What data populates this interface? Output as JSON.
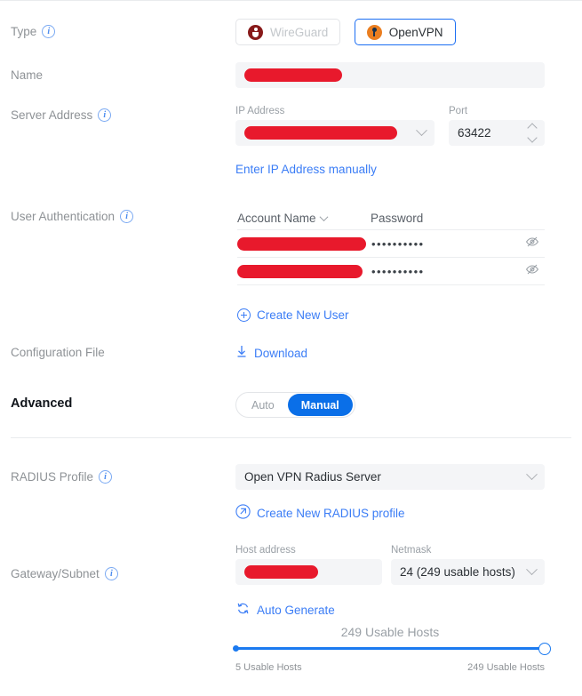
{
  "form": {
    "type": {
      "label": "Type",
      "options": [
        {
          "label": "WireGuard",
          "icon": "wireguard-icon",
          "selected": false,
          "disabled": true
        },
        {
          "label": "OpenVPN",
          "icon": "openvpn-icon",
          "selected": true,
          "disabled": false
        }
      ]
    },
    "name": {
      "label": "Name",
      "value": "",
      "redacted": true
    },
    "server_address": {
      "label": "Server Address",
      "ip_label": "IP Address",
      "ip_value": "",
      "ip_redacted": true,
      "port_label": "Port",
      "port_value": "63422",
      "manual_link": "Enter IP Address manually"
    },
    "user_auth": {
      "label": "User Authentication",
      "columns": [
        "Account Name",
        "Password"
      ],
      "rows": [
        {
          "account": "",
          "redacted": true,
          "password": "••••••••••"
        },
        {
          "account": "",
          "redacted": true,
          "password": "••••••••••"
        }
      ],
      "create_user_link": "Create New User"
    },
    "configuration_file": {
      "label": "Configuration File",
      "download_link": "Download"
    },
    "advanced": {
      "label": "Advanced",
      "modes": [
        {
          "label": "Auto",
          "selected": false
        },
        {
          "label": "Manual",
          "selected": true
        }
      ]
    },
    "radius_profile": {
      "label": "RADIUS Profile",
      "value": "Open VPN Radius Server",
      "create_link": "Create New RADIUS profile"
    },
    "gateway_subnet": {
      "label": "Gateway/Subnet",
      "host_label": "Host address",
      "host_value": "",
      "host_redacted": true,
      "netmask_label": "Netmask",
      "netmask_value": "24 (249 usable hosts)",
      "auto_generate_link": "Auto Generate",
      "slider": {
        "current": "249 Usable Hosts",
        "min_label": "5 Usable Hosts",
        "max_label": "249 Usable Hosts",
        "percent": 100
      }
    }
  },
  "colors": {
    "accent": "#1b6ef3",
    "link": "#3b7df6",
    "redaction": "#e8192c",
    "selected_pill": "#0a6fe8",
    "wireguard": "#881a1a",
    "openvpn": "#ea7e20"
  }
}
